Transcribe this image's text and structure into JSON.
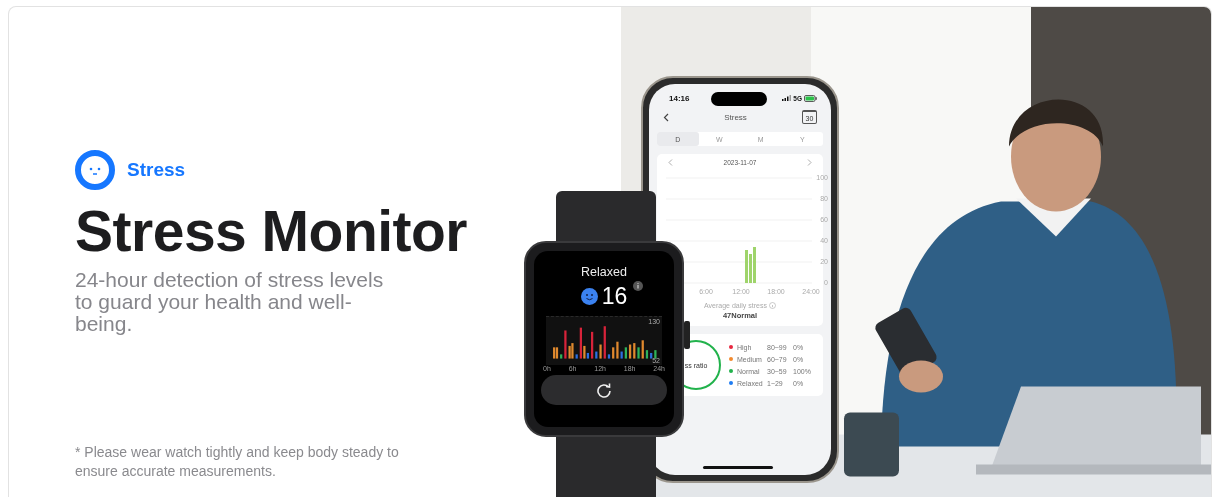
{
  "feature": {
    "label": "Stress"
  },
  "title": "Stress Monitor",
  "description": "24-hour detection of stress levels to guard your health and well-being.",
  "footnote": "* Please wear watch tightly and keep body steady to ensure accurate measurements.",
  "watch": {
    "status": "Relaxed",
    "value": "16",
    "y_labels": [
      "130",
      "52"
    ],
    "x_labels": [
      "0h",
      "6h",
      "12h",
      "18h",
      "24h"
    ]
  },
  "phone": {
    "time": "14:16",
    "network": "5G",
    "title": "Stress",
    "calendar_day": "30",
    "tabs": [
      {
        "label": "D",
        "selected": true
      },
      {
        "label": "W",
        "selected": false
      },
      {
        "label": "M",
        "selected": false
      },
      {
        "label": "Y",
        "selected": false
      }
    ],
    "date": "2023-11-07",
    "y_ticks": [
      "100",
      "80",
      "60",
      "40",
      "20",
      "0"
    ],
    "x_ticks": [
      "6:00",
      "12:00",
      "18:00",
      "24:00"
    ],
    "average_label": "Average daily stress",
    "average_value": "47Normal",
    "ratio_label": "ss ratio",
    "levels": [
      {
        "name": "High",
        "range": "80~99",
        "percent": "0%",
        "color": "#e8263f"
      },
      {
        "name": "Medium",
        "range": "60~79",
        "percent": "0%",
        "color": "#f28a2e"
      },
      {
        "name": "Normal",
        "range": "30~59",
        "percent": "100%",
        "color": "#22b24c"
      },
      {
        "name": "Relaxed",
        "range": "1~29",
        "percent": "0%",
        "color": "#1e7cf2"
      }
    ]
  }
}
